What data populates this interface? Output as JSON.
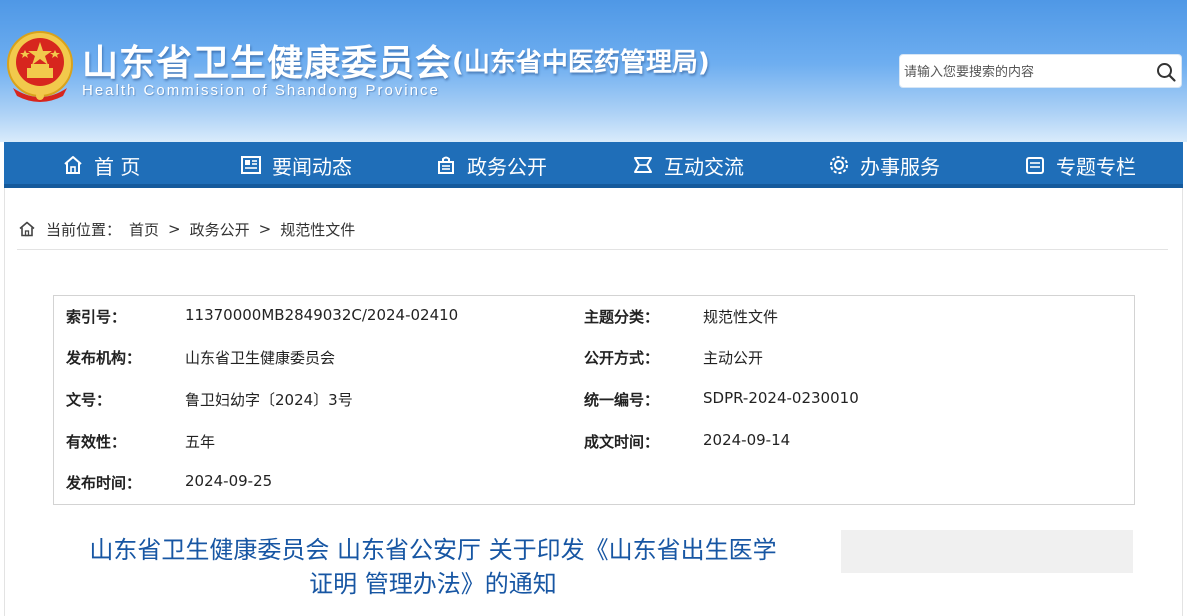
{
  "header": {
    "title": "山东省卫生健康委员会",
    "subtitle": "(山东省中医药管理局)",
    "english_name": "Health  Commission  of  Shandong  Province",
    "emblem_icon": "national-emblem-icon",
    "search_placeholder": "请输入您要搜索的内容",
    "search_icon": "search-icon"
  },
  "nav": {
    "items": [
      {
        "label": "首 页",
        "icon": "home-icon"
      },
      {
        "label": "要闻动态",
        "icon": "news-icon"
      },
      {
        "label": "政务公开",
        "icon": "government-affairs-icon"
      },
      {
        "label": "互动交流",
        "icon": "interaction-icon"
      },
      {
        "label": "办事服务",
        "icon": "service-icon"
      },
      {
        "label": "专题专栏",
        "icon": "topic-icon"
      }
    ]
  },
  "breadcrumb": {
    "prefix": "当前位置：",
    "items": [
      "首页",
      "政务公开",
      "规范性文件"
    ],
    "separator": ">"
  },
  "info": {
    "index_label": "索引号：",
    "index_value": "11370000MB2849032C/2024-02410",
    "topic_label": "主题分类：",
    "topic_value": "规范性文件",
    "publisher_label": "发布机构：",
    "publisher_value": "山东省卫生健康委员会",
    "open_label": "公开方式：",
    "open_value": "主动公开",
    "docno_label": "文号：",
    "docno_value": "鲁卫妇幼字〔2024〕3号",
    "unified_label": "统一编号：",
    "unified_value": "SDPR-2024-0230010",
    "validity_label": "有效性：",
    "validity_value": "五年",
    "created_label": "成文时间：",
    "created_value": "2024-09-14",
    "published_label": "发布时间：",
    "published_value": "2024-09-25"
  },
  "document": {
    "title_line1": "山东省卫生健康委员会 山东省公安厅 关于印发《山东省出生医学",
    "title_line2": "证明 管理办法》的通知"
  },
  "colors": {
    "nav_bg": "#1f6eb8",
    "title_blue": "#1756a3",
    "header_gradient_top": "#4f98e6"
  }
}
